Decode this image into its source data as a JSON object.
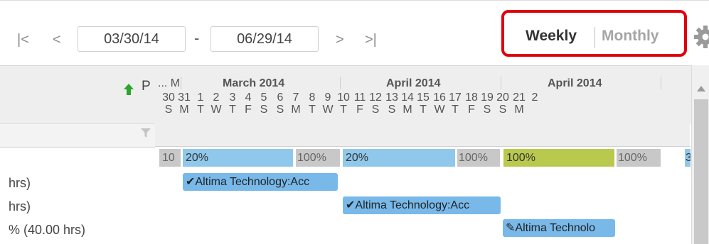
{
  "toolbar": {
    "first_icon": "|<",
    "prev_icon": "<",
    "start_date": "03/30/14",
    "separator": "-",
    "end_date": "06/29/14",
    "next_icon": ">",
    "last_icon": ">|",
    "view_weekly": "Weekly",
    "view_monthly": "Monthly",
    "settings_icon": "gear-icon"
  },
  "grid_header": {
    "sort_column_label": "P",
    "ellipsis_month": "... M",
    "months": [
      "March 2014",
      "April 2014",
      "April 2014"
    ],
    "days": [
      {
        "num": "30",
        "dow": "S"
      },
      {
        "num": "31",
        "dow": "M"
      },
      {
        "num": "1",
        "dow": "T"
      },
      {
        "num": "2",
        "dow": "W"
      },
      {
        "num": "3",
        "dow": "T"
      },
      {
        "num": "4",
        "dow": "F"
      },
      {
        "num": "5",
        "dow": "S"
      },
      {
        "num": "6",
        "dow": "S"
      },
      {
        "num": "7",
        "dow": "M"
      },
      {
        "num": "8",
        "dow": "T"
      },
      {
        "num": "9",
        "dow": "W"
      },
      {
        "num": "10",
        "dow": "T"
      },
      {
        "num": "11",
        "dow": "F"
      },
      {
        "num": "12",
        "dow": "S"
      },
      {
        "num": "13",
        "dow": "S"
      },
      {
        "num": "14",
        "dow": "M"
      },
      {
        "num": "15",
        "dow": "T"
      },
      {
        "num": "16",
        "dow": "W"
      },
      {
        "num": "17",
        "dow": "T"
      },
      {
        "num": "18",
        "dow": "F"
      },
      {
        "num": "19",
        "dow": "S"
      },
      {
        "num": "20",
        "dow": "S"
      },
      {
        "num": "21",
        "dow": "M"
      },
      {
        "num": "2",
        "dow": ""
      }
    ]
  },
  "allocation_bars": [
    "10",
    "20%",
    "100%",
    "20%",
    "100%",
    "100%",
    "100%",
    "3"
  ],
  "rows": [
    {
      "label": "hrs)",
      "task": "Altima Technology:Acc"
    },
    {
      "label": "hrs)",
      "task": "Altima Technology:Acc"
    },
    {
      "label": "% (40.00 hrs)",
      "task": "Altima Technolo"
    }
  ],
  "colors": {
    "allocation_blue": "#8fc8ea",
    "allocation_gray": "#c8c8c8",
    "allocation_green": "#b9c94e",
    "task_blue": "#78b9ea",
    "highlight_red": "#e0000b",
    "sort_arrow_green": "#2aa52a"
  }
}
